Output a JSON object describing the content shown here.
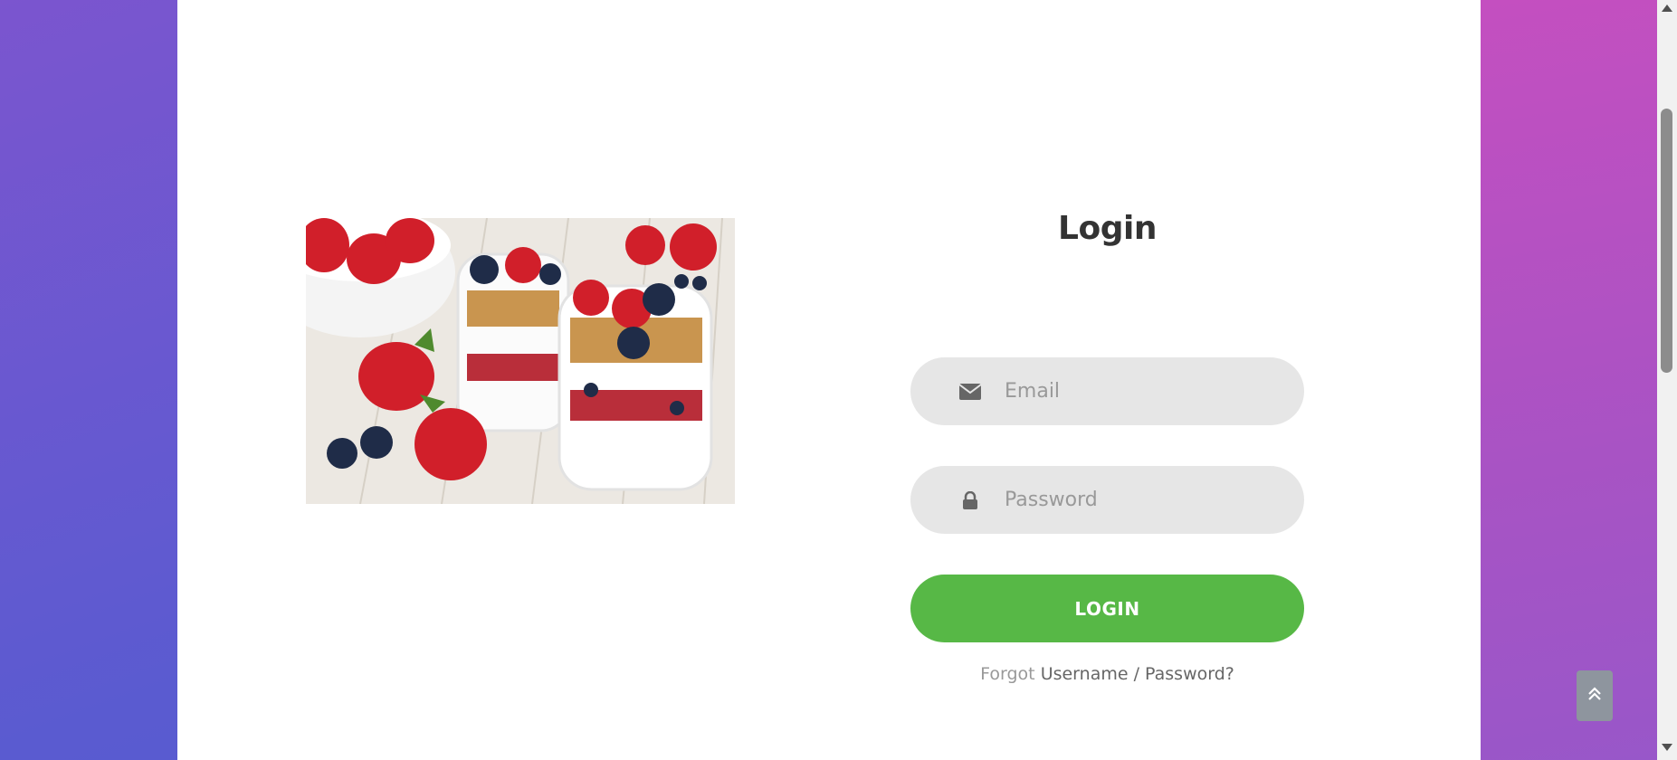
{
  "colors": {
    "bg_left": "#6a58d0",
    "bg_right": "#b653c3",
    "panel": "#ffffff",
    "field_bg": "#e6e6e6",
    "button": "#57b846",
    "title": "#333333"
  },
  "hero_image": {
    "icon": "parfait-photo"
  },
  "login": {
    "title": "Login",
    "email": {
      "placeholder": "Email",
      "value": "",
      "icon": "envelope-icon"
    },
    "password": {
      "placeholder": "Password",
      "value": "",
      "icon": "lock-icon"
    },
    "button_label": "LOGIN",
    "forgot_prefix": "Forgot",
    "forgot_link": "Username / Password?"
  },
  "back_to_top": {
    "icon": "double-chevron-up-icon"
  }
}
